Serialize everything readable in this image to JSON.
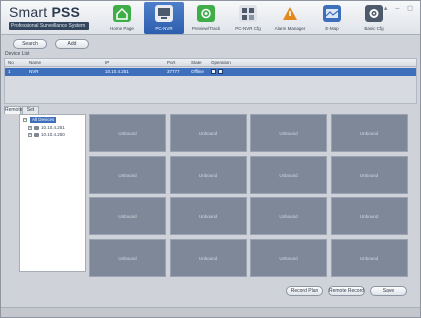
{
  "app": {
    "title_light": "Smart ",
    "title_bold": "PSS",
    "subtitle": "Professional Surveillance System",
    "window_controls": "▴ – ◻"
  },
  "nav": [
    {
      "label": "Home Page",
      "icon": "home-icon",
      "color": "#3fae49",
      "active": false
    },
    {
      "label": "PC-NVR",
      "icon": "nvr-icon",
      "color": "#4d5a6b",
      "active": true
    },
    {
      "label": "Preview/Track",
      "icon": "preview-icon",
      "color": "#3fae49",
      "active": false
    },
    {
      "label": "PC-NVR Cfg",
      "icon": "config-icon",
      "color": "#4d5a6b",
      "active": false
    },
    {
      "label": "Alarm Manager",
      "icon": "alarm-icon",
      "color": "#e28a1f",
      "active": false
    },
    {
      "label": "E-Map",
      "icon": "emap-icon",
      "color": "#3d6fbd",
      "active": false
    },
    {
      "label": "Basic Cfg",
      "icon": "settings-icon",
      "color": "#4d5a6b",
      "active": false
    }
  ],
  "toolbar": {
    "search_label": "Search",
    "add_label": "Add",
    "device_list_label": "Device List"
  },
  "device_table": {
    "columns": [
      "No",
      "Name",
      "IP",
      "Port",
      "State",
      "Operation"
    ],
    "rows": [
      {
        "no": "1",
        "name": "NVR",
        "ip": "10.10.4.251",
        "port": "37777",
        "state": "Offline"
      }
    ]
  },
  "tabs": {
    "tab1": "Remote",
    "tab2": "Set"
  },
  "tree": {
    "root": "All Devices",
    "nodes": [
      "10.10.4.251",
      "10.10.4.250"
    ]
  },
  "grid": {
    "cell_label": "Unbound",
    "rows": 4,
    "cols": 4
  },
  "bottom": {
    "btn1": "Record Plan",
    "btn2": "Remote Record",
    "btn3": "Save"
  }
}
